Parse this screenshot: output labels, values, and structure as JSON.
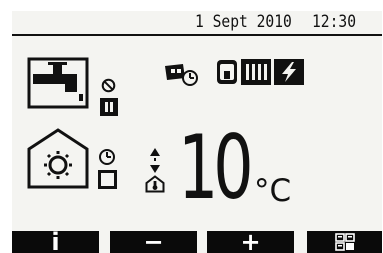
{
  "header": {
    "date": "1 Sept 2010",
    "time": "12:30"
  },
  "zone": {
    "room_temperature": "10",
    "temperature_unit": "°C"
  },
  "function_keys": {
    "f1_label": "i",
    "f2_label": "−",
    "f3_label": "+",
    "f4_icon": "menu-grid-icon"
  },
  "icons": {
    "dhw": "hot-water-tap-icon",
    "dhw_prohibit": "prohibit-icon",
    "dhw_mode": "stop-square-icon",
    "holiday_schedule": "holiday-timer-icon",
    "tank": "cylinder-tank-icon",
    "heater": "electric-heater-icon",
    "boost": "lightning-icon",
    "heating": "heating-house-icon",
    "heating_timer": "clock-icon",
    "heating_mode": "mode-square-icon",
    "temperature_adjust": "up-down-arrows-icon",
    "room_sensor": "room-thermostat-icon"
  },
  "colors": {
    "screen_background": "#f4f4f1",
    "foreground": "#111111",
    "key_background": "#0a0a0a",
    "key_text": "#ffffff"
  }
}
